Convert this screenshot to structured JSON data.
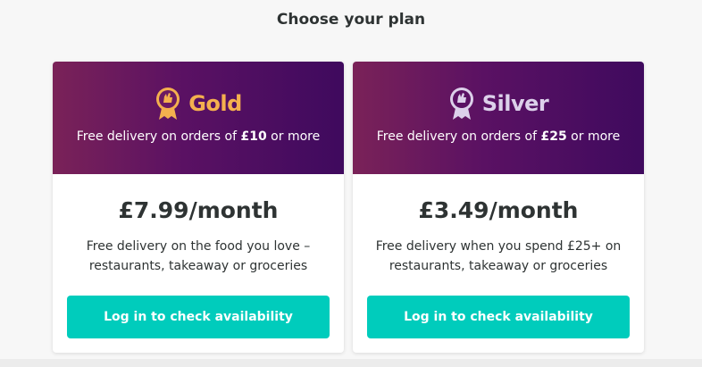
{
  "page": {
    "title": "Choose your plan"
  },
  "plans": [
    {
      "name": "Gold",
      "desc_prefix": "Free delivery on orders of ",
      "desc_amount": "£10",
      "desc_suffix": " or more",
      "price": "£7.99/month",
      "benefit": "Free delivery on the food you love – restaurants, takeaway or groceries",
      "cta_label": "Log in to check availability",
      "icon": "gold-ribbon-badge-icon",
      "accent": "#f4b04e"
    },
    {
      "name": "Silver",
      "desc_prefix": "Free delivery on orders of ",
      "desc_amount": "£25",
      "desc_suffix": " or more",
      "price": "£3.49/month",
      "benefit": "Free delivery when you spend £25+ on restaurants, takeaway or groceries",
      "cta_label": "Log in to check availability",
      "icon": "silver-ribbon-badge-icon",
      "accent": "#dcd0ea"
    }
  ],
  "colors": {
    "header_gradient_start": "#7a2258",
    "header_gradient_end": "#3f0a5e",
    "button": "#00ccbc"
  }
}
